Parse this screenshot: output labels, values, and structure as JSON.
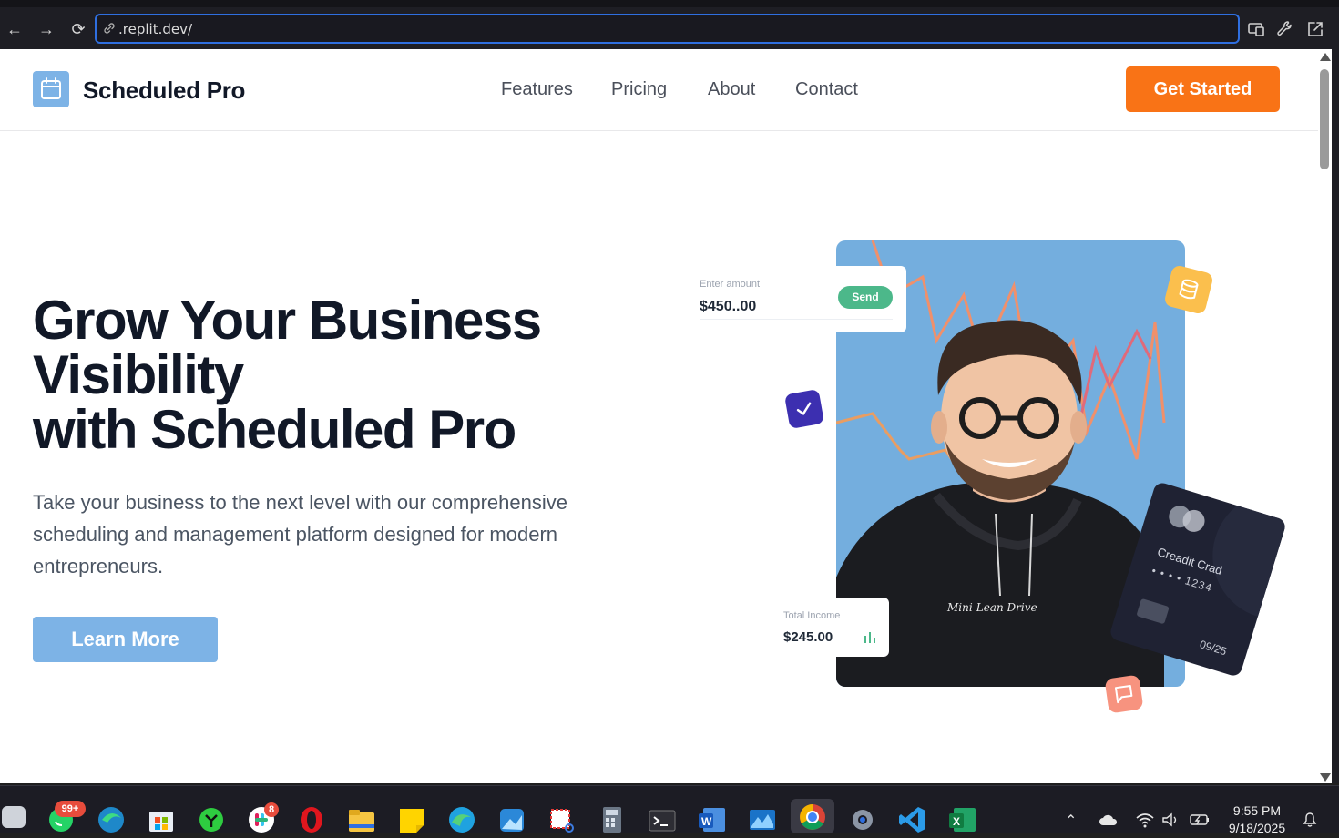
{
  "browser": {
    "url": ".replit.dev/",
    "back_label": "←",
    "forward_label": "→",
    "reload_label": "⟳"
  },
  "header": {
    "brand": "Scheduled Pro",
    "nav": [
      "Features",
      "Pricing",
      "About",
      "Contact"
    ],
    "cta": "Get Started"
  },
  "hero": {
    "title_lines": [
      "Grow Your Business",
      "Visibility",
      "with Scheduled Pro"
    ],
    "subtitle": "Take your business to the next level with our comprehensive scheduling and management platform designed for modern entrepreneurs.",
    "button": "Learn More"
  },
  "illustration": {
    "amount_label": "Enter amount",
    "amount_value": "$450..00",
    "send_label": "Send",
    "income_label": "Total Income",
    "income_value": "$245.00",
    "card_name": "Creadit Crad",
    "card_number": "• • • •   1234",
    "card_expiry": "09/25",
    "hoodie_text": "Mini-Lean Drive"
  },
  "taskbar": {
    "whatsapp_badge": "99+",
    "slack_badge": "8",
    "time": "9:55 PM",
    "date": "9/18/2025"
  },
  "colors": {
    "brand_blue": "#7db3e6",
    "cta_orange": "#f97316",
    "heading": "#111827",
    "send_green": "#4cb88a"
  }
}
